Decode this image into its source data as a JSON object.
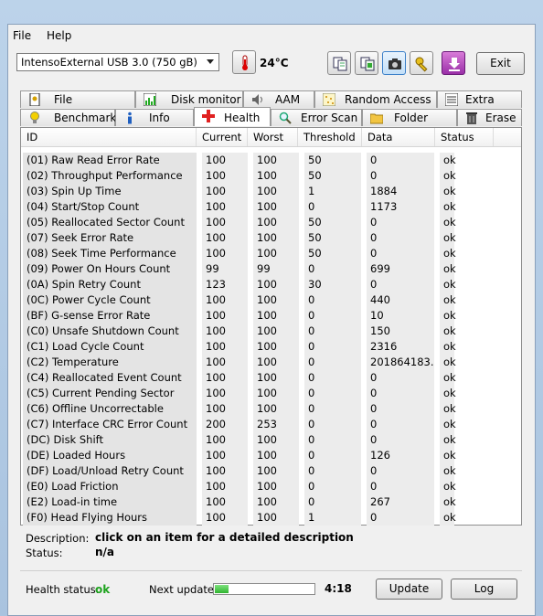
{
  "menu": {
    "file": "File",
    "help": "Help"
  },
  "toolbar": {
    "drive": "IntensoExternal USB 3.0 (750 gB)",
    "temperature": "24°C",
    "exit_label": "Exit",
    "icons": [
      "copy-icon",
      "copy-all-icon",
      "screenshot-icon",
      "options-icon",
      "download-icon"
    ]
  },
  "tabs_top": [
    "File Benchmark",
    "Disk monitor",
    "AAM",
    "Random Access",
    "Extra tests"
  ],
  "tabs_bottom": [
    "Benchmark",
    "Info",
    "Health",
    "Error Scan",
    "Folder Usage",
    "Erase"
  ],
  "active_tab": "Health",
  "table": {
    "headers": [
      "ID",
      "Current",
      "Worst",
      "Threshold",
      "Data",
      "Status"
    ],
    "rows": [
      [
        "(01) Raw Read Error Rate",
        "100",
        "100",
        "50",
        "0",
        "ok"
      ],
      [
        "(02) Throughput Performance",
        "100",
        "100",
        "50",
        "0",
        "ok"
      ],
      [
        "(03) Spin Up Time",
        "100",
        "100",
        "1",
        "1884",
        "ok"
      ],
      [
        "(04) Start/Stop Count",
        "100",
        "100",
        "0",
        "1173",
        "ok"
      ],
      [
        "(05) Reallocated Sector Count",
        "100",
        "100",
        "50",
        "0",
        "ok"
      ],
      [
        "(07) Seek Error Rate",
        "100",
        "100",
        "50",
        "0",
        "ok"
      ],
      [
        "(08) Seek Time Performance",
        "100",
        "100",
        "50",
        "0",
        "ok"
      ],
      [
        "(09) Power On Hours Count",
        "99",
        "99",
        "0",
        "699",
        "ok"
      ],
      [
        "(0A) Spin Retry Count",
        "123",
        "100",
        "30",
        "0",
        "ok"
      ],
      [
        "(0C) Power Cycle Count",
        "100",
        "100",
        "0",
        "440",
        "ok"
      ],
      [
        "(BF) G-sense Error Rate",
        "100",
        "100",
        "0",
        "10",
        "ok"
      ],
      [
        "(C0) Unsafe Shutdown Count",
        "100",
        "100",
        "0",
        "150",
        "ok"
      ],
      [
        "(C1) Load Cycle Count",
        "100",
        "100",
        "0",
        "2316",
        "ok"
      ],
      [
        "(C2) Temperature",
        "100",
        "100",
        "0",
        "201864183...",
        "ok"
      ],
      [
        "(C4) Reallocated Event Count",
        "100",
        "100",
        "0",
        "0",
        "ok"
      ],
      [
        "(C5) Current Pending Sector",
        "100",
        "100",
        "0",
        "0",
        "ok"
      ],
      [
        "(C6) Offline Uncorrectable",
        "100",
        "100",
        "0",
        "0",
        "ok"
      ],
      [
        "(C7) Interface CRC Error Count",
        "200",
        "253",
        "0",
        "0",
        "ok"
      ],
      [
        "(DC) Disk Shift",
        "100",
        "100",
        "0",
        "0",
        "ok"
      ],
      [
        "(DE) Loaded Hours",
        "100",
        "100",
        "0",
        "126",
        "ok"
      ],
      [
        "(DF) Load/Unload Retry Count",
        "100",
        "100",
        "0",
        "0",
        "ok"
      ],
      [
        "(E0) Load Friction",
        "100",
        "100",
        "0",
        "0",
        "ok"
      ],
      [
        "(E2) Load-in time",
        "100",
        "100",
        "0",
        "267",
        "ok"
      ],
      [
        "(F0) Head Flying Hours",
        "100",
        "100",
        "1",
        "0",
        "ok"
      ]
    ]
  },
  "description": {
    "label": "Description:",
    "text": "click on an item for a detailed description",
    "status_label": "Status:",
    "status_value": "n/a"
  },
  "footer": {
    "health_label": "Health status:",
    "health_value": "ok",
    "next_update_label": "Next update:",
    "next_update_progress": 0.14,
    "next_update_time": "4:18",
    "update_label": "Update",
    "log_label": "Log"
  }
}
